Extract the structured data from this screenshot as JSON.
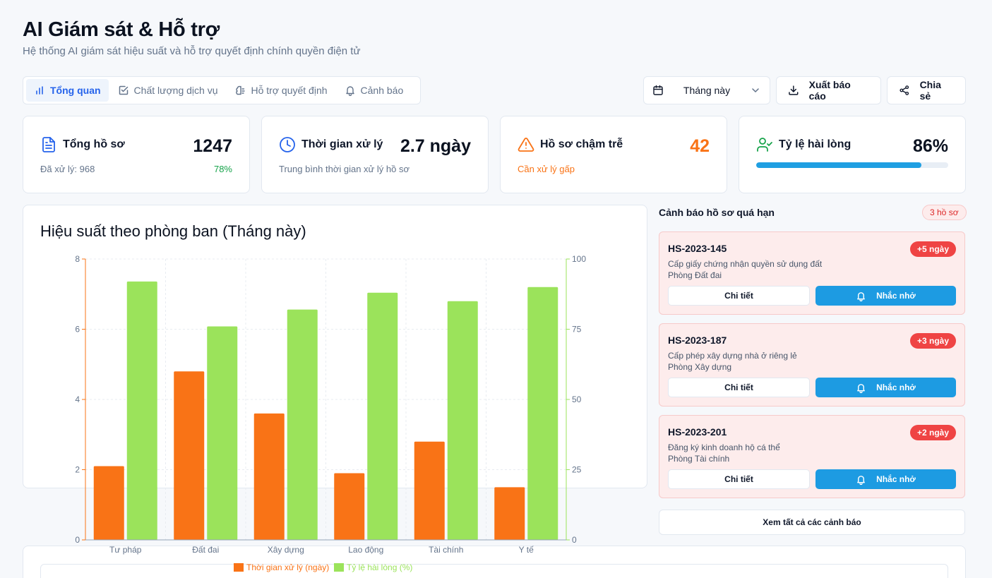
{
  "header": {
    "title": "AI Giám sát & Hỗ trợ",
    "subtitle": "Hệ thống AI giám sát hiệu suất và hỗ trợ quyết định chính quyền điện tử"
  },
  "tabs": [
    {
      "label": "Tổng quan",
      "icon": "bar-chart-icon",
      "active": true
    },
    {
      "label": "Chất lượng dịch vụ",
      "icon": "checkbox-icon",
      "active": false
    },
    {
      "label": "Hỗ trợ quyết định",
      "icon": "brain-icon",
      "active": false
    },
    {
      "label": "Cảnh báo",
      "icon": "bell-icon",
      "active": false
    }
  ],
  "toolbar": {
    "period_value": "Tháng này",
    "export_label": "Xuất báo cáo",
    "share_label": "Chia sẻ"
  },
  "stats": {
    "total": {
      "label": "Tổng hồ sơ",
      "value": "1247",
      "sub": "Đã xử lý: 968",
      "pct": "78%"
    },
    "time": {
      "label": "Thời gian xử lý",
      "value": "2.7 ngày",
      "sub": "Trung bình thời gian xử lý hồ sơ"
    },
    "late": {
      "label": "Hồ sơ chậm trễ",
      "value": "42",
      "sub": "Cần xử lý gấp"
    },
    "satisfaction": {
      "label": "Tỷ lệ hài lòng",
      "value": "86%",
      "progress": 0.86
    }
  },
  "colors": {
    "primary": "#2563eb",
    "orange": "#f97316",
    "green": "#9be35b",
    "accent_blue": "#1d9be2",
    "danger": "#ef4444",
    "success": "#16a34a"
  },
  "chart_title": "Hiệu suất theo phòng ban (Tháng này)",
  "chart_data": {
    "type": "bar",
    "title": "Hiệu suất theo phòng ban (Tháng này)",
    "categories": [
      "Tư pháp",
      "Đất đai",
      "Xây dựng",
      "Lao động",
      "Tài chính",
      "Y tế"
    ],
    "series": [
      {
        "name": "Thời gian xử lý (ngày)",
        "axis": "left",
        "color": "#f97316",
        "values": [
          2.1,
          4.8,
          3.6,
          1.9,
          2.8,
          1.5
        ]
      },
      {
        "name": "Tỷ lệ hài lòng (%)",
        "axis": "right",
        "color": "#9be35b",
        "values": [
          92,
          76,
          82,
          88,
          85,
          90
        ]
      }
    ],
    "y_left": {
      "min": 0,
      "max": 8,
      "ticks": [
        "0",
        "2",
        "4",
        "6",
        "8"
      ]
    },
    "y_right": {
      "min": 0,
      "max": 100,
      "ticks": [
        "0",
        "25",
        "50",
        "75",
        "100"
      ]
    },
    "grid": true,
    "legend": "bottom"
  },
  "alerts": {
    "title": "Cảnh báo hồ sơ quá hạn",
    "badge": "3 hồ sơ",
    "items": [
      {
        "code": "HS-2023-145",
        "days": "+5 ngày",
        "desc": "Cấp giấy chứng nhận quyền sử dụng đất",
        "dept": "Phòng Đất đai"
      },
      {
        "code": "HS-2023-187",
        "days": "+3 ngày",
        "desc": "Cấp phép xây dựng nhà ở riêng lẻ",
        "dept": "Phòng Xây dựng"
      },
      {
        "code": "HS-2023-201",
        "days": "+2 ngày",
        "desc": "Đăng ký kinh doanh hộ cá thể",
        "dept": "Phòng Tài chính"
      }
    ],
    "detail_label": "Chi tiết",
    "remind_label": "Nhắc nhở",
    "view_all_label": "Xem tất cả các cảnh báo"
  }
}
